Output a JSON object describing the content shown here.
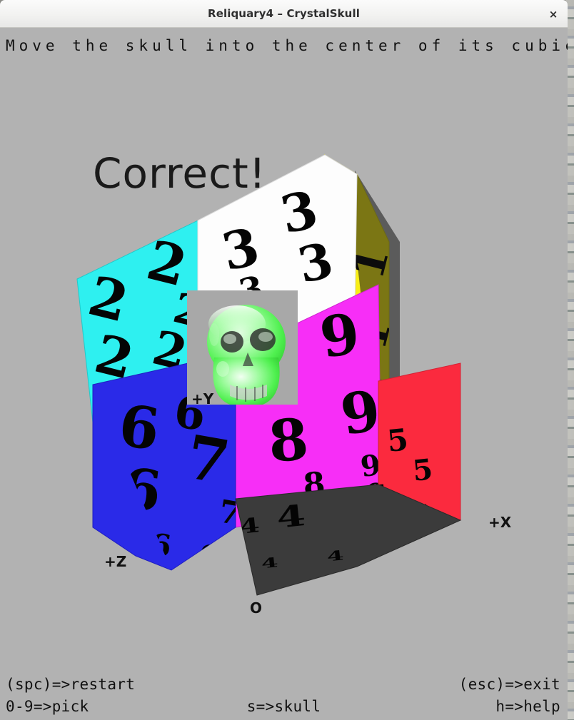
{
  "window": {
    "title": "Reliquary4 – CrystalSkull",
    "close_label": "×"
  },
  "prompt": {
    "text": "Move the skull into the center of its cubical tomb."
  },
  "status": {
    "banner": "Correct!"
  },
  "axes": {
    "x": "+X",
    "y": "+Y",
    "z": "+Z",
    "origin": "O"
  },
  "cube": {
    "faces": [
      {
        "name": "cyan-face",
        "digit": "2",
        "color": "#2ef0f0"
      },
      {
        "name": "white-face",
        "digit": "3",
        "color": "#fdfdfd"
      },
      {
        "name": "blue-face",
        "digit": "6",
        "color": "#2a2ae8"
      },
      {
        "name": "magenta-face",
        "digit": "9",
        "color": "#f72ef7"
      },
      {
        "name": "red-face",
        "digit": "5",
        "color": "#fb2a3e"
      },
      {
        "name": "dark-face",
        "digit": "4",
        "color": "#3b3b3b"
      },
      {
        "name": "yellow-face",
        "digit": "1",
        "color": "#f8ee16"
      },
      {
        "name": "green-face",
        "digit": "7",
        "color": "#35e835"
      }
    ],
    "center_digits": {
      "seven": "7",
      "eight": "8"
    },
    "skull_color": "#6dfa6d",
    "window_color": "#a8a8a8"
  },
  "footer": {
    "row1": {
      "left": "(spc)=>restart",
      "right": "(esc)=>exit"
    },
    "row2": {
      "left": "0-9=>pick",
      "center": "s=>skull",
      "right": "h=>help"
    }
  },
  "colors": {
    "canvas_bg": "#b2b2b2",
    "titlebar_bg": "#f2f2f1",
    "text": "#111111"
  }
}
